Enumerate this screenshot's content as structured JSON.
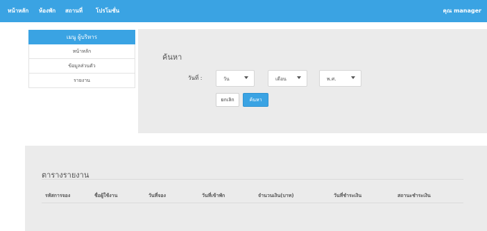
{
  "navbar": {
    "items": [
      "หน้าหลัก",
      "ห้องพัก",
      "สถานที่",
      "โปรโมชั่น"
    ],
    "user": "คุณ manager"
  },
  "sidebar": {
    "header": "เมนู ผู้บริหาร",
    "items": [
      "หน้าหลัก",
      "ข้อมูลส่วนตัว",
      "รายงาน"
    ]
  },
  "search": {
    "title": "ค้นหา",
    "date_label": "วันที่ :",
    "day_value": "วัน",
    "month_value": "เดือน",
    "year_value": "พ.ศ.",
    "cancel_label": "ยกเลิก",
    "search_label": "ค้นหา"
  },
  "report": {
    "title": "ตารางรายงาน",
    "columns": [
      "รหัสการจอง",
      "ชื่อผู้ใช้งาน",
      "วันที่จอง",
      "วันที่เข้าพัก",
      "จำนวนเงิน(บาท)",
      "วันที่ชำระเงิน",
      "สถานะชำระเงิน"
    ]
  },
  "colors": {
    "primary": "#3aa3e3",
    "panel_bg": "#ebebeb"
  }
}
